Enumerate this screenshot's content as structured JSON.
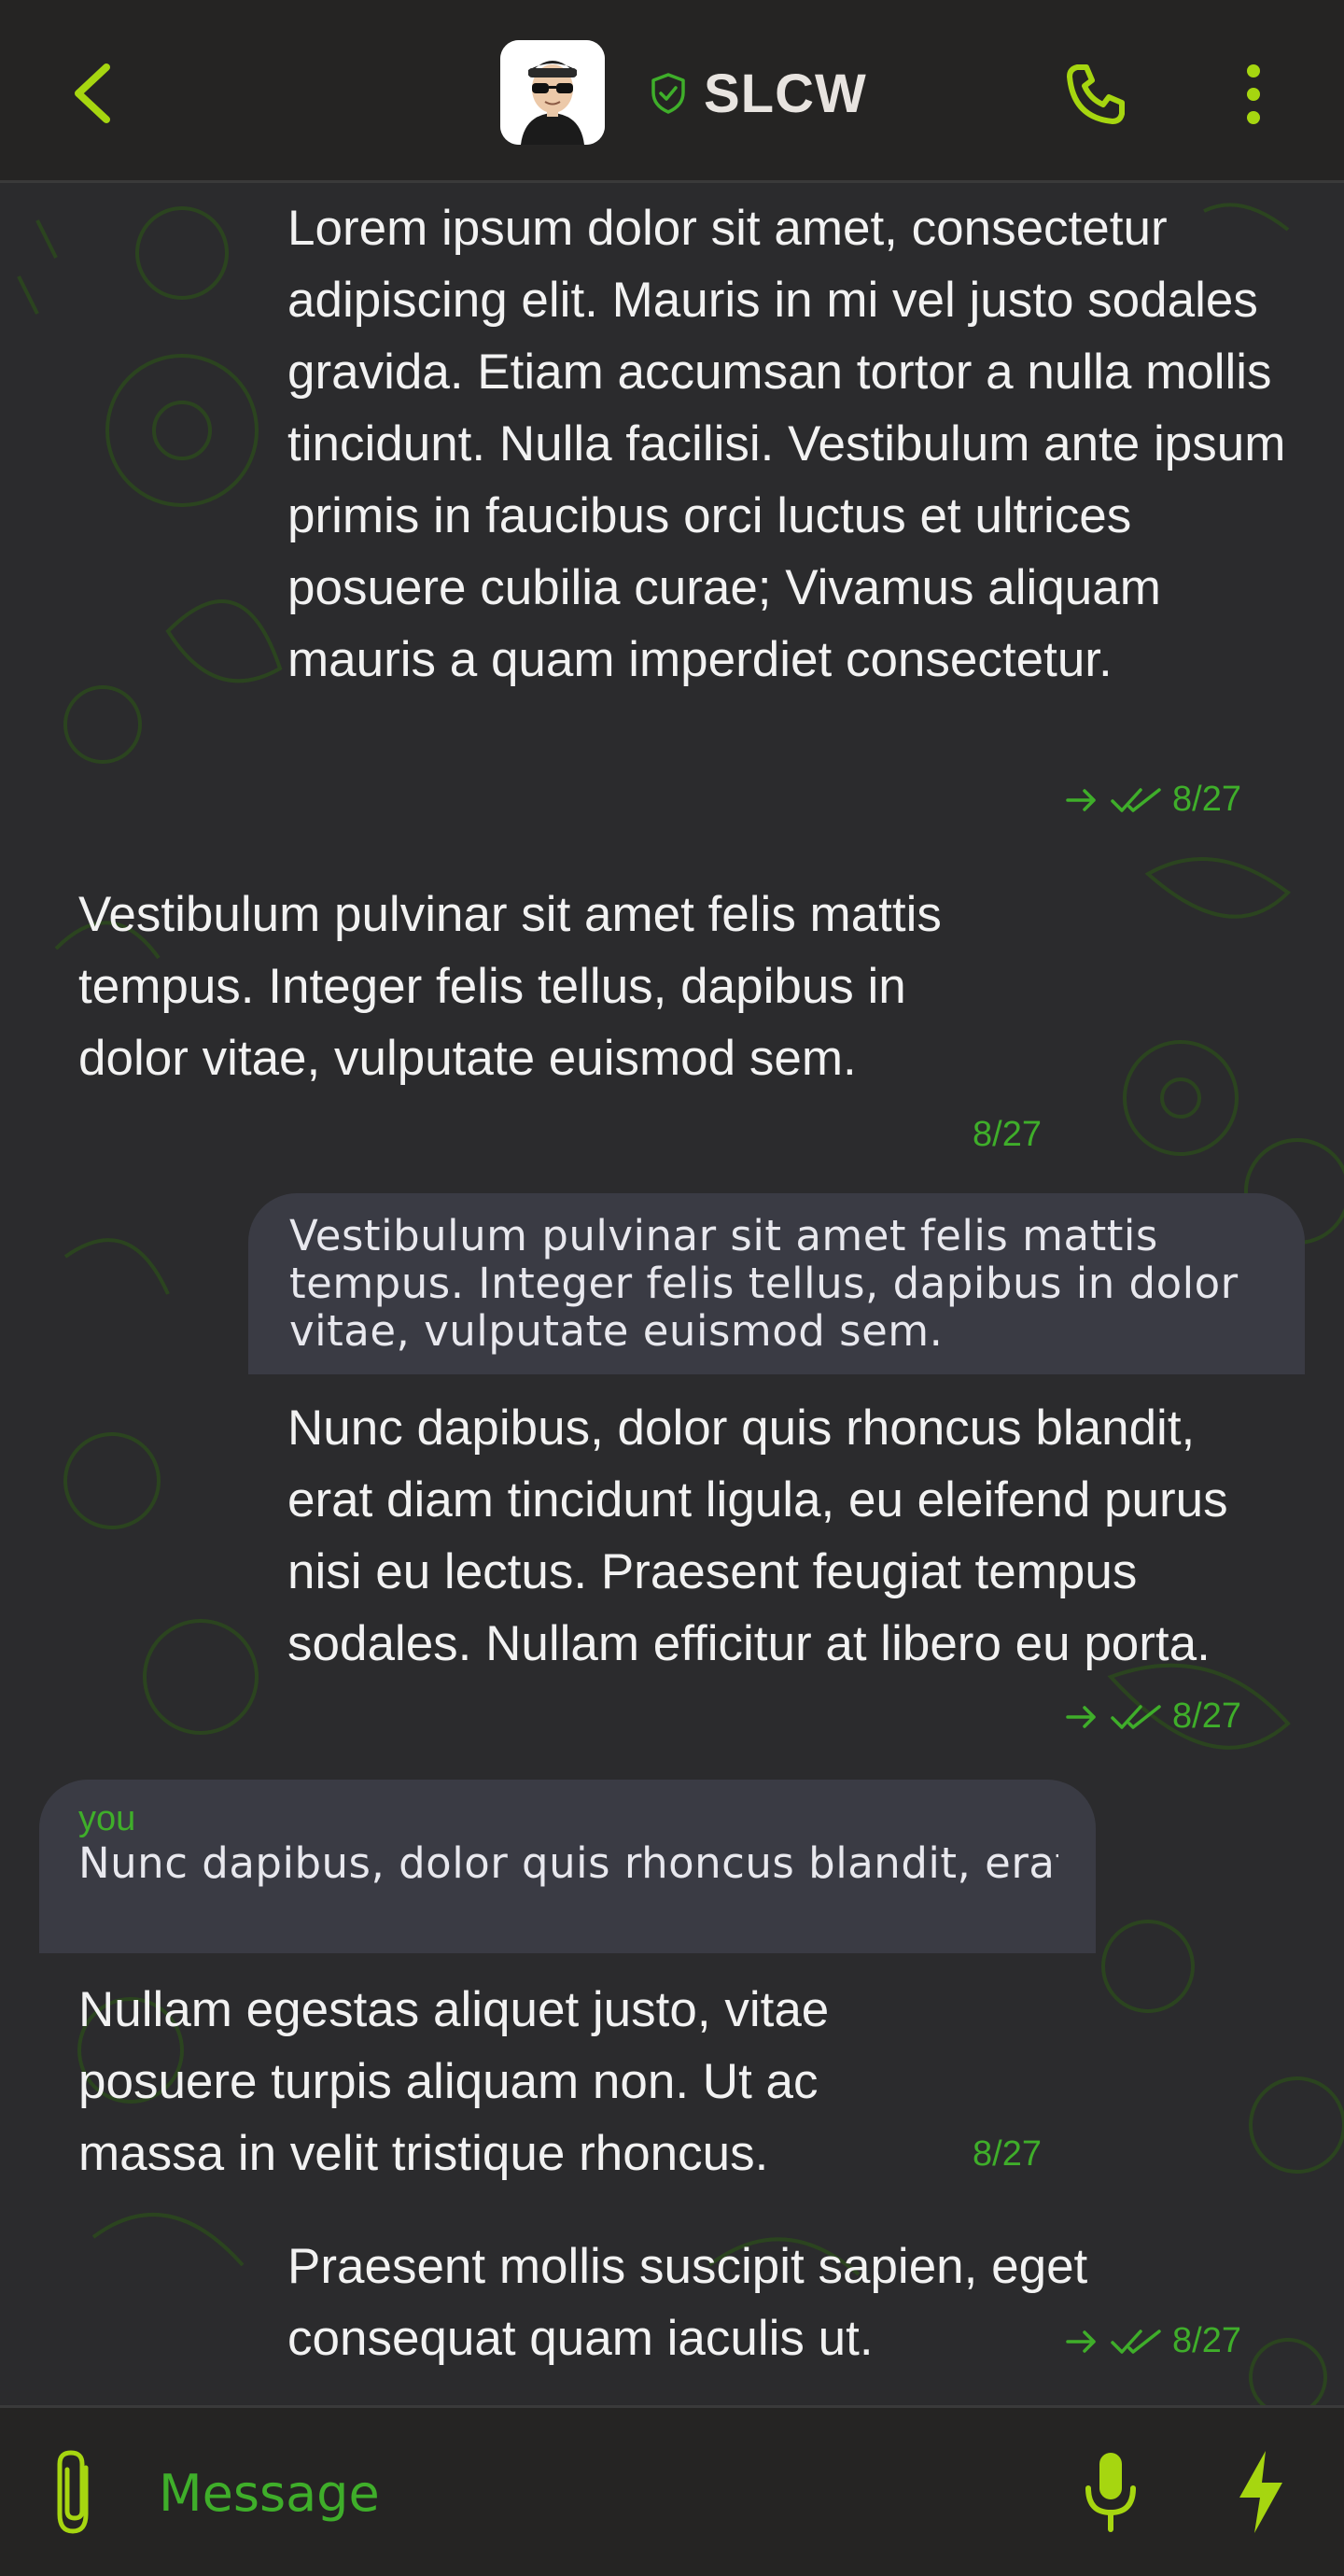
{
  "colors": {
    "accent": "#a6d610",
    "accent_green": "#3fae2a",
    "background": "#2b2b2d",
    "header": "#252423",
    "quote_bg": "#3a3b44"
  },
  "header": {
    "title": "SLCW",
    "icons": {
      "back": "chevron-left-icon",
      "verified": "shield-check-icon",
      "call": "phone-icon",
      "menu": "more-vertical-icon"
    }
  },
  "messages": [
    {
      "id": "m1",
      "direction": "outgoing",
      "text": "Lorem ipsum dolor sit amet, consectetur adipiscing elit. Mauris in mi vel justo sodales gravida. Etiam accumsan tortor a nulla mollis tincidunt. Nulla facilisi. Vestibulum ante ipsum primis in faucibus orci luctus et ultrices posuere cubilia curae; Vivamus aliquam mauris a quam imperdiet consectetur.",
      "date": "8/27",
      "status": "read"
    },
    {
      "id": "m2",
      "direction": "incoming",
      "text": "Vestibulum pulvinar sit amet felis mattis tempus. Integer felis tellus, dapibus in dolor vitae, vulputate euismod sem.",
      "date": "8/27"
    },
    {
      "id": "m3",
      "direction": "outgoing",
      "quote": {
        "text": "Vestibulum pulvinar sit amet felis mattis tempus. Integer felis tellus, dapibus in dolor vitae, vulputate euismod sem."
      },
      "text": "Nunc dapibus, dolor quis rhoncus blandit, erat diam tincidunt ligula, eu eleifend purus nisi eu lectus. Praesent feugiat tempus sodales. Nullam efficitur at libero eu porta.",
      "date": "8/27",
      "status": "read"
    },
    {
      "id": "m4",
      "direction": "incoming",
      "quote": {
        "author": "you",
        "text": "Nunc dapibus, dolor quis rhoncus blandit, erat diam tincidunt ligula, eu eleifend purus ..."
      },
      "text": "Nullam egestas aliquet justo, vitae posuere turpis aliquam non. Ut ac massa in velit tristique rhoncus.",
      "date": "8/27"
    },
    {
      "id": "m5",
      "direction": "outgoing",
      "text": "Praesent mollis suscipit sapien, eget consequat quam iaculis ut.",
      "date": "8/27",
      "status": "read"
    }
  ],
  "composer": {
    "placeholder": "Message",
    "icons": {
      "attach": "paperclip-icon",
      "mic": "microphone-icon",
      "send": "lightning-icon"
    }
  }
}
